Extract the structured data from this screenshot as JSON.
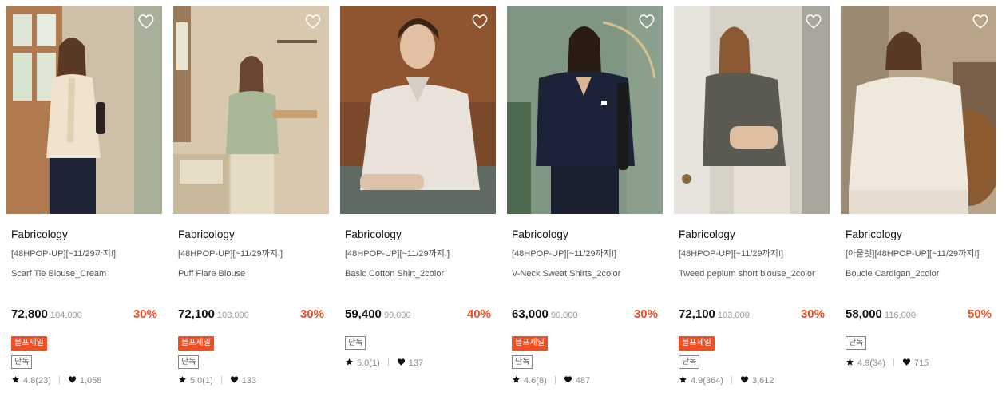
{
  "colors": {
    "accent": "#f04f23",
    "text": "#111111",
    "muted": "#888888"
  },
  "products": [
    {
      "brand": "Fabricology",
      "promo": "[48HPOP-UP][~11/29까지!]",
      "name": "Scarf Tie Blouse_Cream",
      "price": "72,800",
      "original_price": "104,000",
      "discount": "30%",
      "sale_badge": "블프세일",
      "exclusive_badge": "단독",
      "rating": "4.8(23)",
      "likes": "1,058",
      "has_sale_badge": true
    },
    {
      "brand": "Fabricology",
      "promo": "[48HPOP-UP][~11/29까지!]",
      "name": "Puff Flare Blouse",
      "price": "72,100",
      "original_price": "103,000",
      "discount": "30%",
      "sale_badge": "블프세일",
      "exclusive_badge": "단독",
      "rating": "5.0(1)",
      "likes": "133",
      "has_sale_badge": true
    },
    {
      "brand": "Fabricology",
      "promo": "[48HPOP-UP][~11/29까지!]",
      "name": "Basic Cotton Shirt_2color",
      "price": "59,400",
      "original_price": "99,000",
      "discount": "40%",
      "exclusive_badge": "단독",
      "rating": "5.0(1)",
      "likes": "137",
      "has_sale_badge": false
    },
    {
      "brand": "Fabricology",
      "promo": "[48HPOP-UP][~11/29까지!]",
      "name": "V-Neck Sweat Shirts_2color",
      "price": "63,000",
      "original_price": "90,000",
      "discount": "30%",
      "sale_badge": "블프세일",
      "exclusive_badge": "단독",
      "rating": "4.6(8)",
      "likes": "487",
      "has_sale_badge": true
    },
    {
      "brand": "Fabricology",
      "promo": "[48HPOP-UP][~11/29까지!]",
      "name": "Tweed peplum short blouse_2color",
      "price": "72,100",
      "original_price": "103,000",
      "discount": "30%",
      "sale_badge": "블프세일",
      "exclusive_badge": "단독",
      "rating": "4.9(364)",
      "likes": "3,612",
      "has_sale_badge": true
    },
    {
      "brand": "Fabricology",
      "promo": "[아울렛][48HPOP-UP][~11/29까지!]",
      "name": "Boucle Cardigan_2color",
      "price": "58,000",
      "original_price": "116,000",
      "discount": "50%",
      "exclusive_badge": "단독",
      "rating": "4.9(34)",
      "likes": "715",
      "has_sale_badge": false
    }
  ]
}
